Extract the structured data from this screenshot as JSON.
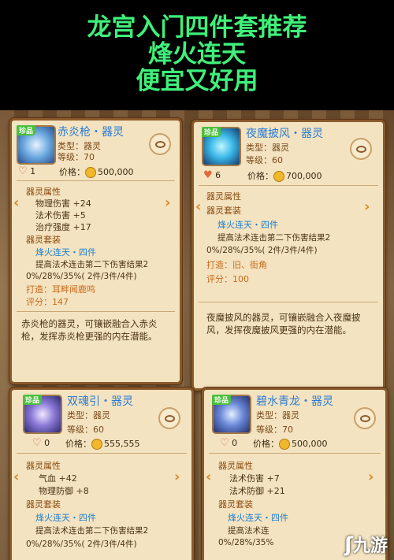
{
  "banner": {
    "line1": "龙宫入门四件套推荐",
    "line2": "烽火连天",
    "line3": "便宜又好用"
  },
  "cards": [
    {
      "rarity": "珍品",
      "name": "赤炎枪・器灵",
      "type": "类型：器灵",
      "level": "等级：70",
      "likes": "1",
      "price_label": "价格：",
      "price": "500,000",
      "attr_header": "器灵属性",
      "attrs": [
        "物理伤害 +24",
        "法术伤害 +5",
        "治疗强度 +17"
      ],
      "set_header": "器灵套装",
      "set_name": "烽火连天・四件",
      "set_desc1": "提高法术连击第二下伤害结果2",
      "set_desc2": "0%/28%/35%( 2件/3件/4件)",
      "forge": "打造：耳畔闻鹿鸣",
      "score": "评分：147",
      "desc": "赤炎枪的器灵，可镶嵌融合入赤炎枪，发挥赤炎枪更强的内在潜能。"
    },
    {
      "rarity": "珍品",
      "name": "夜魔披风・器灵",
      "type": "类型：器灵",
      "level": "等级：60",
      "likes": "6",
      "price_label": "价格：",
      "price": "700,000",
      "attr_header": "器灵属性",
      "set_header": "器灵套装",
      "set_name": "烽火连天・四件",
      "set_desc1": "提高法术连击第二下伤害结果2",
      "set_desc2": "0%/28%/35%( 2件/3件/4件)",
      "forge": "打造：旧、街角",
      "score": "评分：100",
      "desc": "夜魔披风的器灵，可镶嵌融合入夜魔披风，发挥夜魔披风更强的内在潜能。"
    },
    {
      "rarity": "珍品",
      "name": "双魂引・器灵",
      "type": "类型：器灵",
      "level": "等级：60",
      "likes": "0",
      "price_label": "价格：",
      "price": "555,555",
      "attr_header": "器灵属性",
      "attrs": [
        "气血 +42",
        "物理防御 +8"
      ],
      "set_header": "器灵套装",
      "set_name": "烽火连天・四件",
      "set_desc1": "提高法术连击第二下伤害结果2",
      "set_desc2": "0%/28%/35%( 2件/3件/4件)"
    },
    {
      "rarity": "珍品",
      "name": "碧水青龙・器灵",
      "type": "类型：器灵",
      "level": "等级：70",
      "likes": "0",
      "price_label": "价格：",
      "price": "500,000",
      "attr_header": "器灵属性",
      "attrs": [
        "法术伤害 +7",
        "法术防御 +21"
      ],
      "set_header": "器灵套装",
      "set_name": "烽火连天・四件",
      "set_desc1": "提高法术连",
      "set_desc2": "0%/28%/35%"
    }
  ],
  "watermark": "九游",
  "colors": {
    "banner_text": "#3ff07a",
    "item_name": "#2a7bd4",
    "set_name": "#1e7fd0",
    "card_bg": "#f4e3c0",
    "card_border": "#8a5a2b"
  },
  "icons": [
    "eye-icon",
    "heart-icon",
    "coin-icon",
    "arrow-left-icon",
    "arrow-right-icon"
  ]
}
